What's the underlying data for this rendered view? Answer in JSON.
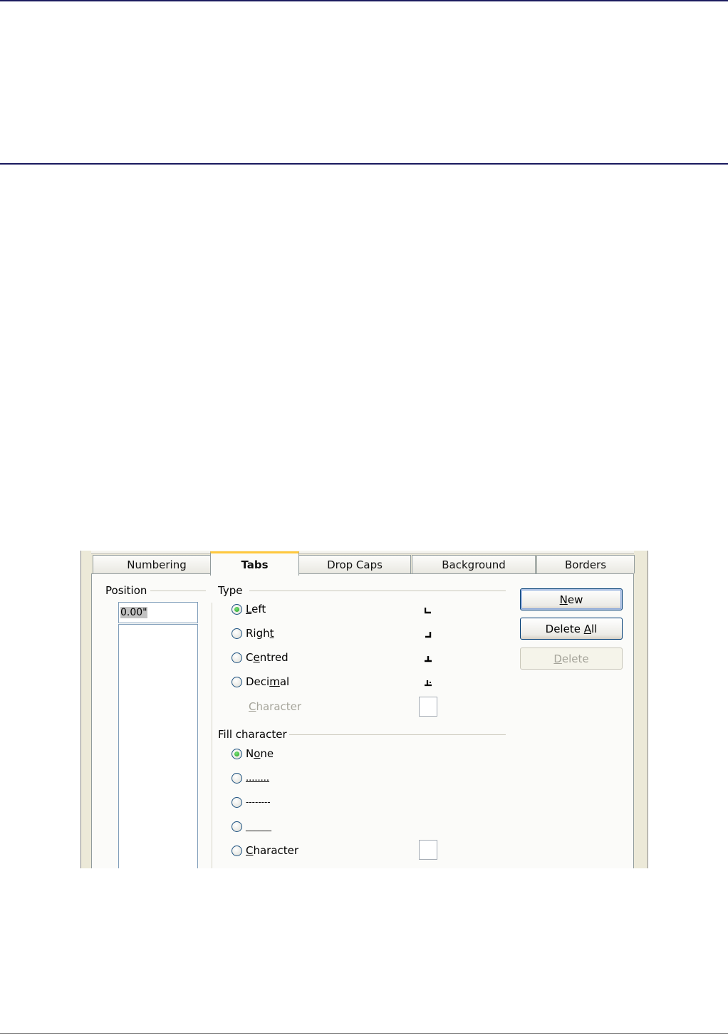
{
  "tabs": [
    {
      "label": "Numbering"
    },
    {
      "label": "Tabs"
    },
    {
      "label": "Drop Caps"
    },
    {
      "label": "Background"
    },
    {
      "label": "Borders"
    }
  ],
  "position": {
    "group_label": "Position",
    "value": "0.00\""
  },
  "type_group": {
    "label": "Type",
    "options": [
      {
        "mnemonic": "L",
        "rest": "eft",
        "checked": true,
        "icon": "tab-left-icon"
      },
      {
        "pre": "Righ",
        "mnemonic": "t",
        "checked": false,
        "icon": "tab-right-icon"
      },
      {
        "pre": "C",
        "mnemonic": "e",
        "rest": "ntred",
        "checked": false,
        "icon": "tab-centre-icon"
      },
      {
        "pre": "Deci",
        "mnemonic": "m",
        "rest": "al",
        "checked": false,
        "icon": "tab-decimal-icon"
      }
    ],
    "character_mnemonic": "C",
    "character_rest": "haracter"
  },
  "fill_group": {
    "label": "Fill character",
    "none_pre": "N",
    "none_mnemonic": "o",
    "none_rest": "ne",
    "dots": "........",
    "dashes": "--------",
    "underscores": "______",
    "character_mnemonic": "C",
    "character_rest": "haracter"
  },
  "buttons": {
    "new_mnemonic": "N",
    "new_rest": "ew",
    "delete_all_pre": "Delete ",
    "delete_all_mnemonic": "A",
    "delete_all_rest": "ll",
    "delete_mnemonic": "D",
    "delete_rest": "elete"
  },
  "colors": {
    "dialog_bg": "#ece9d8",
    "active_tab_accent": "#ffc83d",
    "radio_checked": "#21a121",
    "header_rule": "#1a1a5e"
  }
}
